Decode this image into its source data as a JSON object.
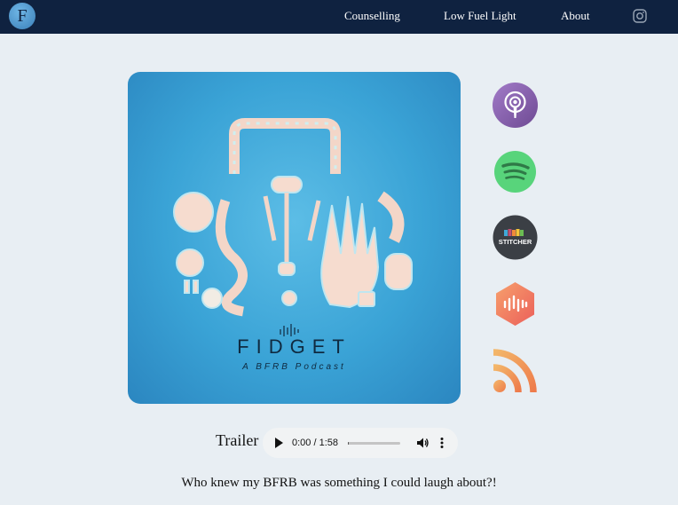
{
  "nav": {
    "logo_letter": "F",
    "links": [
      "Counselling",
      "Low Fuel Light",
      "About"
    ],
    "instagram_icon": "instagram-icon"
  },
  "cover": {
    "title": "FIDGET",
    "subtitle": "A BFRB Podcast"
  },
  "platforms": [
    {
      "name": "apple-podcasts-icon",
      "color": "#8a5fb0"
    },
    {
      "name": "spotify-icon",
      "color": "#58d47b"
    },
    {
      "name": "stitcher-icon",
      "color": "#3b3f45",
      "label": "STITCHER"
    },
    {
      "name": "castbox-icon",
      "color": "#f0735a"
    },
    {
      "name": "rss-icon",
      "color": "#f09a54"
    }
  ],
  "trailer": {
    "label": "Trailer",
    "time": "0:00 / 1:58",
    "progress": 0.02
  },
  "tagline": "Who knew my BFRB was something I could laugh about?!",
  "colors": {
    "navbar": "#0f2240",
    "background": "#e8eef3",
    "cover_blue": "#3aa3d6"
  }
}
